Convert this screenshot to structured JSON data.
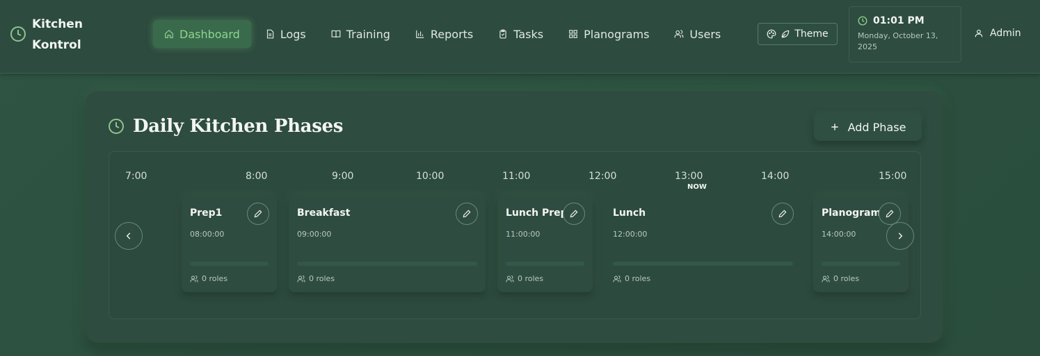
{
  "brand": {
    "name": "Kitchen Kontrol",
    "icon": "clock-icon"
  },
  "nav": {
    "items": [
      {
        "label": "Dashboard",
        "icon": "home-icon",
        "active": true
      },
      {
        "label": "Logs",
        "icon": "file-icon"
      },
      {
        "label": "Training",
        "icon": "book-icon"
      },
      {
        "label": "Reports",
        "icon": "bar-chart-icon"
      },
      {
        "label": "Tasks",
        "icon": "clipboard-icon"
      },
      {
        "label": "Planograms",
        "icon": "grid-icon"
      },
      {
        "label": "Users",
        "icon": "users-icon"
      }
    ]
  },
  "theme": {
    "label": "Theme",
    "icons": [
      "palette-icon",
      "leaf-icon"
    ]
  },
  "clock": {
    "time": "01:01 PM",
    "date": "Monday, October 13, 2025"
  },
  "user": {
    "label": "Admin",
    "icon": "user-icon"
  },
  "main": {
    "title": "Daily Kitchen Phases",
    "add_button_label": "Add Phase",
    "timeline": {
      "ticks": [
        "7:00",
        "8:00",
        "9:00",
        "10:00",
        "11:00",
        "12:00",
        "13:00",
        "14:00",
        "15:00"
      ],
      "now_label": "NOW",
      "phases": [
        {
          "name": "Prep1",
          "start": "08:00:00",
          "roles": "0 roles"
        },
        {
          "name": "Breakfast",
          "start": "09:00:00",
          "roles": "0 roles"
        },
        {
          "name": "Lunch Prep",
          "start": "11:00:00",
          "roles": "0 roles"
        },
        {
          "name": "Lunch",
          "start": "12:00:00",
          "roles": "0 roles"
        },
        {
          "name": "Planogram",
          "start": "14:00:00",
          "roles": "0 roles"
        }
      ]
    }
  },
  "colors": {
    "accent": "#8fd48f",
    "background": "#2c5040",
    "card": "#2e4c40"
  }
}
